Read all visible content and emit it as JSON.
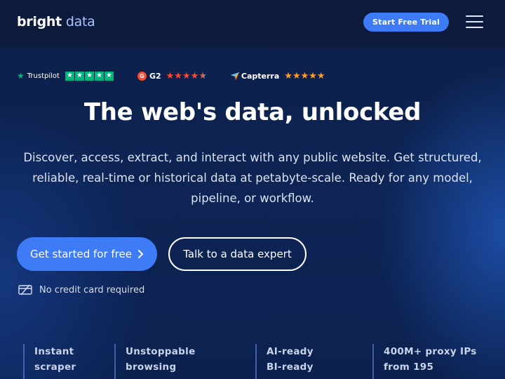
{
  "header": {
    "logo_bold": "bright",
    "logo_light": "data",
    "trial_label": "Start Free Trial"
  },
  "ratings": {
    "trustpilot": {
      "label": "Trustpilot",
      "stars": 5
    },
    "g2": {
      "badge": "G",
      "label": "G2",
      "stars": 4.5
    },
    "capterra": {
      "label": "Capterra",
      "stars": 5
    }
  },
  "hero": {
    "title": "The web's data, unlocked",
    "subtitle": "Discover, access, extract, and interact with any public website. Get structured, reliable, real-time or historical data at petabyte-scale. Ready for any model, pipeline, or workflow.",
    "cta_primary": "Get started for free",
    "cta_secondary": "Talk to a data expert",
    "no_card": "No credit card required"
  },
  "features": [
    {
      "line1": "Instant",
      "line2": "scraper"
    },
    {
      "line1": "Unstoppable",
      "line2": "browsing"
    },
    {
      "line1": "AI-ready",
      "line2": "BI-ready"
    },
    {
      "line1": "400M+ proxy IPs",
      "line2": "from 195"
    }
  ],
  "colors": {
    "accent": "#3d7bf7",
    "trustpilot_green": "#00b67a",
    "g2_red": "#ff492c",
    "capterra_orange": "#ff9d28"
  },
  "icons": {
    "menu": "hamburger-menu-icon",
    "chevron": "chevron-right-icon",
    "card": "credit-card-icon"
  }
}
